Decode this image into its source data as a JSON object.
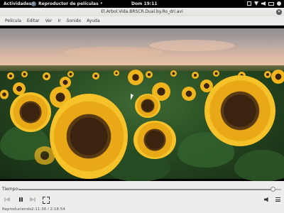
{
  "topbar": {
    "activities": "Actividades",
    "app_name": "Reproductor de películas",
    "clock": "Dom 19:11",
    "icons": [
      "window-icon",
      "network-icon",
      "volume-icon",
      "battery-icon",
      "user-icon"
    ]
  },
  "window": {
    "title": "El.Arbol.Vida.BRSCR.Dual.by.Ro_dri.avi"
  },
  "menubar": {
    "items": [
      "Película",
      "Editar",
      "Ver",
      "Ir",
      "Sonido",
      "Ayuda"
    ]
  },
  "controls": {
    "time_label": "Tiempo:",
    "progress": 0.97,
    "status": "Reproduciendo",
    "time": "2:11:36 / 2:18:54"
  },
  "colors": {
    "panel": "#000000",
    "chrome": "#ededeb",
    "accent_sunflower": "#f6c22a"
  }
}
